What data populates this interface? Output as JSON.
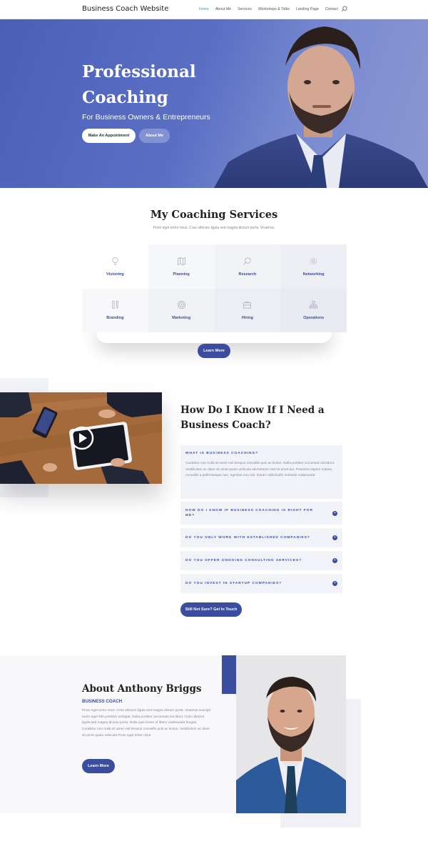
{
  "nav": {
    "logo": "Business Coach Website",
    "items": [
      "Home",
      "About Me",
      "Services",
      "Workshops & Talks",
      "Landing Page",
      "Contact"
    ],
    "active": "Home"
  },
  "hero": {
    "title": "Professional Coaching",
    "subtitle": "For Business Owners & Entrepreneurs",
    "primary_button": "Make An Appointment",
    "secondary_button": "About Me"
  },
  "services": {
    "title": "My Coaching Services",
    "subtitle": "Proin eget tortor risus. Cras ultricies ligula sed magna dictum porta. Vivamus.",
    "items": [
      {
        "label": "Visioning",
        "icon": "lightbulb-icon"
      },
      {
        "label": "Planning",
        "icon": "map-icon"
      },
      {
        "label": "Research",
        "icon": "search-icon"
      },
      {
        "label": "Networking",
        "icon": "gear-icon"
      },
      {
        "label": "Branding",
        "icon": "pen-ruler-icon"
      },
      {
        "label": "Marketing",
        "icon": "target-icon"
      },
      {
        "label": "Hiring",
        "icon": "briefcase-icon"
      },
      {
        "label": "Operations",
        "icon": "org-chart-icon"
      }
    ],
    "button": "Learn More"
  },
  "faq": {
    "title": "How Do I Know If I Need a Business Coach?",
    "open_question": "WHAT IS BUSINESS COACHING?",
    "open_answer": "Curabitur non nulla sit amet nisl tempus convallis quis ac lectus. Nulla porttitor accumsan tincidunt. Vestibulum ac diam sit amet quam vehicula elementum sed sit amet dui. Praesent sapien massa, convallis a pellentesque nec, egestas non nisi. Donec sollicitudin molestie malesuada.",
    "questions": [
      "HOW DO I KNOW IF BUSINESS COACHING IS RIGHT FOR ME?",
      "DO YOU ONLY WORK WITH ESTABLISHED COMPANIES?",
      "DO YOU OFFER ONGOING CONSULTING SERVICES?",
      "DO YOU INVEST IN STARTUP COMPANIES?"
    ],
    "button": "Still Not Sure? Get In Touch"
  },
  "about": {
    "title": "About Anthony Briggs",
    "role": "BUSINESS COACH",
    "text": "Proin eget tortor risus. Cras ultricies ligula sed magna dictum porta. Vivamus suscipit tortor eget felis porttitor volutpat. Nulla porttitor accumsan tincidunt. Cras ultricies ligula sed magna dictum porta. Nulla quis lorem ut libero malesuada feugiat. Curabitur non nulla sit amet nisl tempus convallis quis ac lectus. Vestibulum ac diam sit amet quam vehicula Proin eget tortor risus.",
    "button": "Learn More"
  },
  "colors": {
    "accent": "#3b4d9e",
    "hero_gradient_start": "#4a5fb8",
    "active_link": "#2e9fd9",
    "panel_bg": "#f2f3f8"
  }
}
